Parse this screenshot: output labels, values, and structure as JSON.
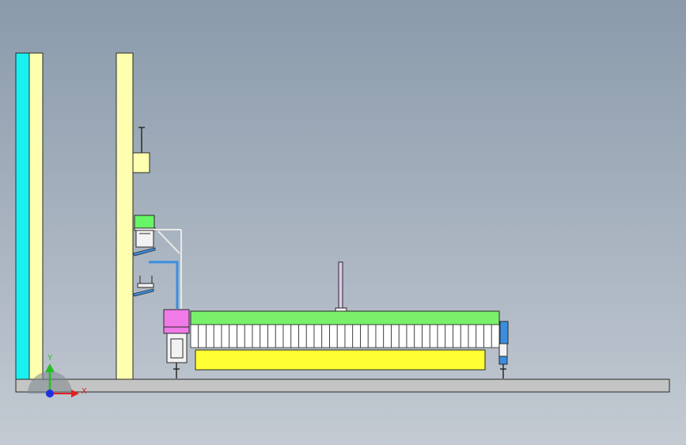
{
  "viewport": {
    "background_top": "#8a9aab",
    "background_bottom": "#c3cad2"
  },
  "model": {
    "colors": {
      "cyan_panel": "#19f0f0",
      "column": "#ffffb0",
      "edge": "#2a2a2a",
      "green_block": "#66f566",
      "green_belt": "#7af06a",
      "pink_unit": "#f07ae8",
      "yellow_base": "#ffff33",
      "blue_part": "#3a8ee0",
      "floor": "#c4c4c4",
      "lavender_rod": "#e0c8f0"
    },
    "roller_count": 40
  },
  "triad": {
    "x_label": "X",
    "y_label": "Y",
    "x_color": "#e02020",
    "y_color": "#22c022",
    "z_color": "#2030e0"
  }
}
